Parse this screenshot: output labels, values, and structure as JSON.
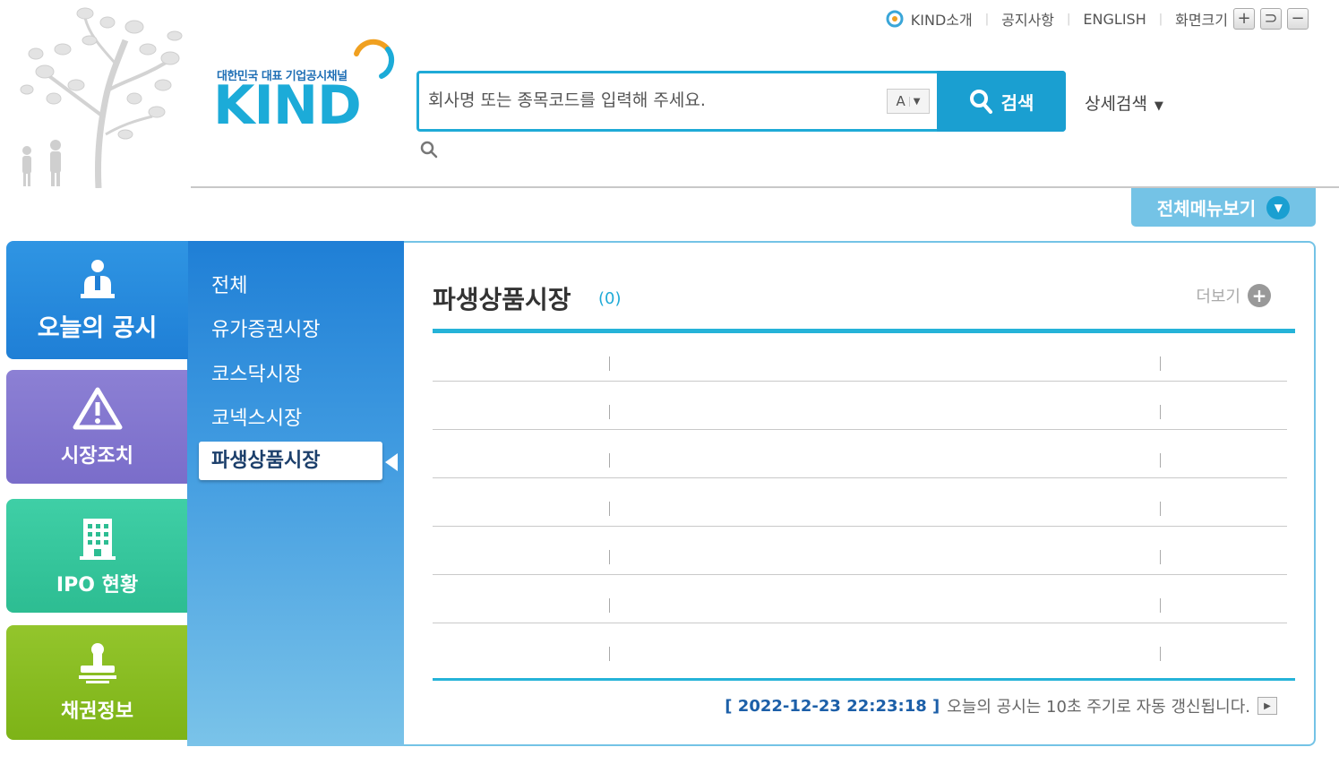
{
  "header": {
    "logo_sub": "대한민국 대표 기업공시채널",
    "logo_main": "KIND",
    "util_links": {
      "intro": "KIND소개",
      "notice": "공지사항",
      "english": "ENGLISH",
      "screen_size": "화면크기"
    },
    "size_buttons": {
      "plus": "+",
      "reset": "⊃",
      "minus": "−"
    },
    "search": {
      "placeholder": "회사명 또는 종목코드를 입력해 주세요.",
      "value": "",
      "aa_label": "A",
      "button_label": "검색"
    },
    "detail_search": "상세검색",
    "all_menu": "전체메뉴보기"
  },
  "tabs": [
    {
      "label": "오늘의 공시",
      "icon": "person-icon"
    },
    {
      "label": "시장조치",
      "icon": "warning-icon"
    },
    {
      "label": "IPO 현황",
      "icon": "building-icon"
    },
    {
      "label": "채권정보",
      "icon": "stamp-icon"
    }
  ],
  "submenu": [
    {
      "label": "전체"
    },
    {
      "label": "유가증권시장"
    },
    {
      "label": "코스닥시장"
    },
    {
      "label": "코넥스시장"
    },
    {
      "label": "파생상품시장",
      "active": true
    }
  ],
  "content": {
    "title": "파생상품시장",
    "count": "(0)",
    "more_label": "더보기",
    "row_count": 7,
    "timestamp": "[ 2022-12-23 22:23:18 ]",
    "refresh_text": "오늘의 공시는 10초 주기로 자동 갱신됩니다."
  },
  "colors": {
    "accent": "#1faad7",
    "tab_today": "#1f7fd6",
    "tab_market": "#7a6dca",
    "tab_ipo": "#2dbd92",
    "tab_bond": "#7db317"
  }
}
